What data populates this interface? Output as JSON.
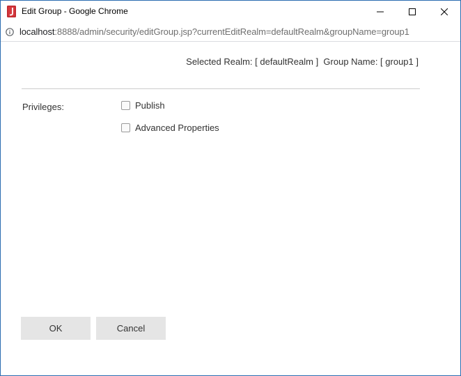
{
  "window": {
    "title": "Edit Group - Google Chrome"
  },
  "address": {
    "host": "localhost",
    "rest": ":8888/admin/security/editGroup.jsp?currentEditRealm=defaultRealm&groupName=group1"
  },
  "header": {
    "realm_info": "Selected Realm: [ defaultRealm ]  Group Name: [ group1 ]"
  },
  "privileges": {
    "label": "Privileges:",
    "options": [
      {
        "label": "Publish",
        "checked": false
      },
      {
        "label": "Advanced Properties",
        "checked": false
      }
    ]
  },
  "buttons": {
    "ok_label": "OK",
    "cancel_label": "Cancel"
  },
  "colors": {
    "app_icon": "#c0282d",
    "window_border": "#2b6cb0",
    "button_bg": "#e5e5e5"
  }
}
